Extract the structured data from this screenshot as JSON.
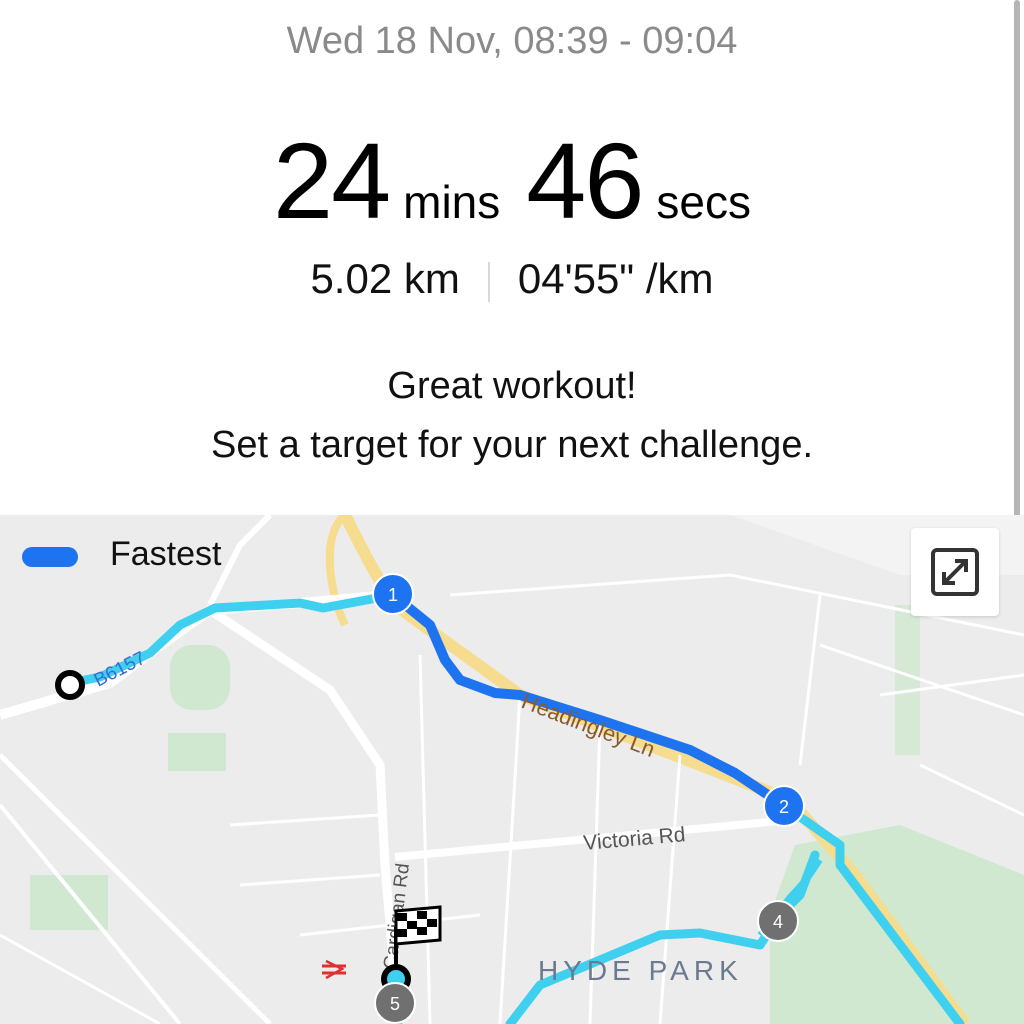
{
  "summary": {
    "date_range": "Wed 18 Nov, 08:39 - 09:04",
    "minutes": "24",
    "minutes_unit": "mins",
    "seconds": "46",
    "seconds_unit": "secs",
    "distance": "5.02 km",
    "pace": "04'55\" /km",
    "message_line1": "Great workout!",
    "message_line2": "Set a target for your next challenge."
  },
  "map": {
    "legend_label": "Fastest",
    "legend_color": "#1e73f0",
    "route_color": "#3fd0f0",
    "fastest_color": "#1e73f0",
    "road_labels": {
      "b6157": "B6157",
      "headingley": "Headingley Ln",
      "victoria": "Victoria Rd",
      "cardigan": "Cardigan Rd",
      "hyde_park": "HYDE PARK"
    },
    "markers": [
      "1",
      "2",
      "4",
      "5"
    ],
    "icons": {
      "expand": "expand-icon",
      "finish": "checkered-flag-icon",
      "station": "rail-station-icon"
    }
  }
}
